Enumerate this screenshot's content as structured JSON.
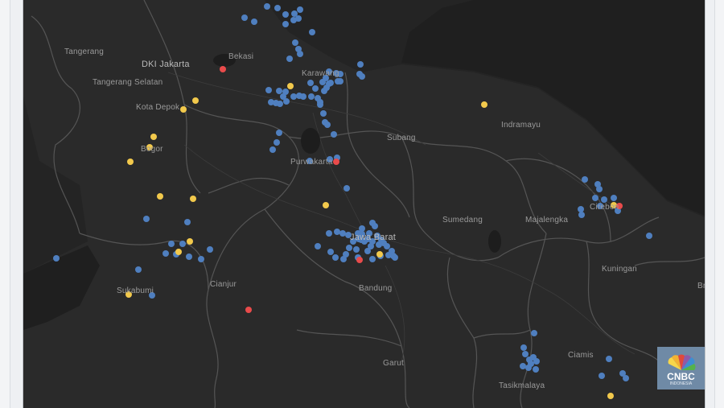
{
  "map": {
    "background_color": "#242424",
    "land_color": "#2b2b2b",
    "sea_color": "#1c1c1c",
    "boundary_color": "#5e5e5e",
    "colors": {
      "blue": "#4f7fbf",
      "yellow": "#f2c94c",
      "red": "#e94b4b"
    }
  },
  "places": [
    {
      "id": "tangerang",
      "name": "Tangerang"
    },
    {
      "id": "dki-jakarta",
      "name": "DKI Jakarta"
    },
    {
      "id": "bekasi",
      "name": "Bekasi"
    },
    {
      "id": "tangerang-selatan",
      "name": "Tangerang Selatan"
    },
    {
      "id": "kota-depok",
      "name": "Kota Depok"
    },
    {
      "id": "karawang",
      "name": "Karawang"
    },
    {
      "id": "bogor",
      "name": "Bogor"
    },
    {
      "id": "indramayu",
      "name": "Indramayu"
    },
    {
      "id": "subang",
      "name": "Subang"
    },
    {
      "id": "purwakarta",
      "name": "Purwakarta"
    },
    {
      "id": "cirebon",
      "name": "Cirebon"
    },
    {
      "id": "sumedang",
      "name": "Sumedang"
    },
    {
      "id": "majalengka",
      "name": "Majalengka"
    },
    {
      "id": "jawa-barat",
      "name": "Jawa Barat"
    },
    {
      "id": "kuningan",
      "name": "Kuningan"
    },
    {
      "id": "cianjur",
      "name": "Cianjur"
    },
    {
      "id": "sukabumi",
      "name": "Sukabumi"
    },
    {
      "id": "bandung",
      "name": "Bandung"
    },
    {
      "id": "brebes",
      "name": "Bre"
    },
    {
      "id": "ciamis",
      "name": "Ciamis"
    },
    {
      "id": "garut",
      "name": "Garut"
    },
    {
      "id": "tasikmalaya",
      "name": "Tasikmalaya"
    }
  ],
  "logo": {
    "text": "CNBC",
    "subtext": "INDONESIA"
  }
}
